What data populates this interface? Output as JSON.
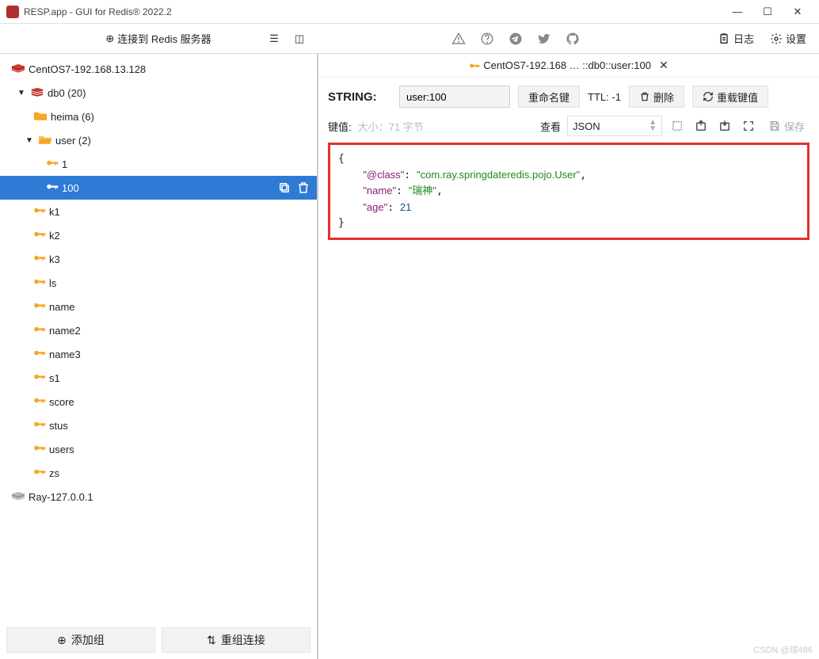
{
  "window": {
    "title": "RESP.app - GUI for Redis® 2022.2"
  },
  "toolbar": {
    "connect_label": "连接到 Redis 服务器",
    "log_label": "日志",
    "settings_label": "设置"
  },
  "tree": {
    "server": {
      "label": "CentOS7-192.168.13.128"
    },
    "db": {
      "label": "db0  (20)"
    },
    "folders": [
      {
        "label": "heima (6)",
        "expanded": false
      },
      {
        "label": "user (2)",
        "expanded": true
      }
    ],
    "user_keys": [
      {
        "label": "1",
        "selected": false
      },
      {
        "label": "100",
        "selected": true
      }
    ],
    "siblings": [
      "k1",
      "k2",
      "k3",
      "ls",
      "name",
      "name2",
      "name3",
      "s1",
      "score",
      "stus",
      "users",
      "zs"
    ],
    "server2": {
      "label": "Ray-127.0.0.1"
    }
  },
  "bottom": {
    "add_group": "添加组",
    "regroup": "重组连接"
  },
  "tab": {
    "title": "CentOS7-192.168 … ::db0::user:100"
  },
  "key": {
    "type": "STRING:",
    "name": "user:100",
    "rename": "重命名键",
    "ttl_label": "TTL:",
    "ttl_value": "-1",
    "delete": "删除",
    "reload": "重载键值"
  },
  "value": {
    "label": "键值:",
    "meta": "大小：71 字节",
    "view_label": "查看",
    "view_mode": "JSON",
    "save": "保存",
    "json": {
      "class_key": "\"@class\"",
      "class_val": "\"com.ray.springdateredis.pojo.User\"",
      "name_key": "\"name\"",
      "name_val": "\"瑞神\"",
      "age_key": "\"age\"",
      "age_val": "21"
    }
  },
  "watermark": "CSDN @瑞486"
}
